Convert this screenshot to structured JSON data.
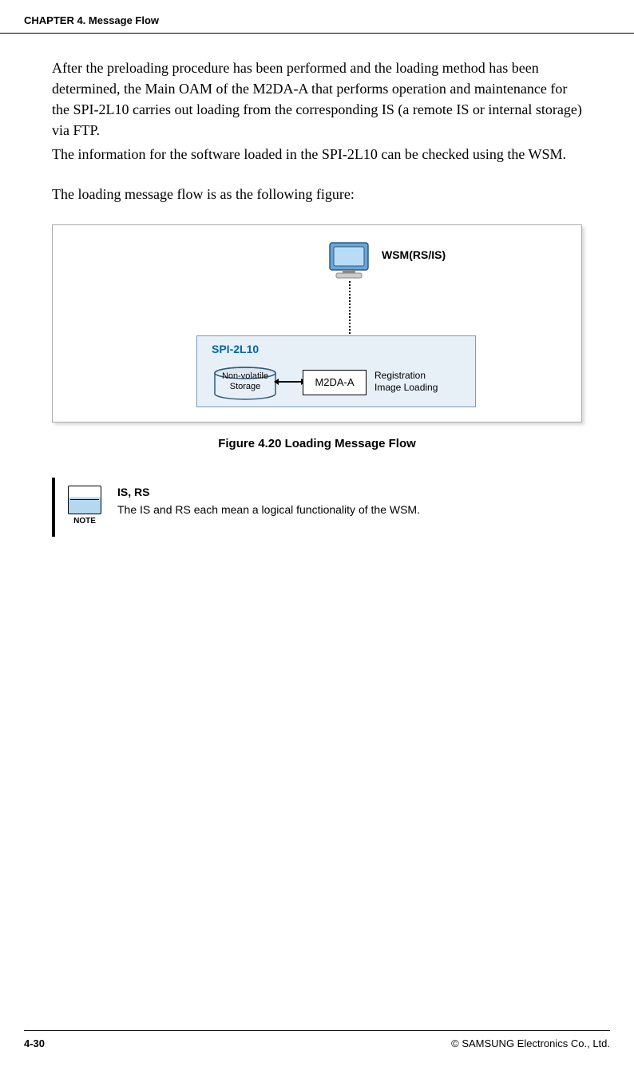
{
  "header": {
    "chapter": "CHAPTER 4. Message Flow"
  },
  "body": {
    "para1": "After the preloading procedure has been performed and the loading method has been determined, the Main OAM of the M2DA-A that performs operation and maintenance for the SPI-2L10 carries out loading from the corresponding IS (a remote IS or internal storage) via FTP.",
    "para2": "The information for the software loaded in the SPI-2L10 can be checked using the WSM.",
    "para3": "The loading message flow is as the following figure:"
  },
  "diagram": {
    "wsm_label": "WSM(RS/IS)",
    "spi_label": "SPI-2L10",
    "storage_line1": "Non-volatile",
    "storage_line2": "Storage",
    "m2da": "M2DA-A",
    "reg_line1": "Registration",
    "reg_line2": "Image Loading"
  },
  "figure_caption": "Figure 4.20    Loading Message Flow",
  "note": {
    "icon_label": "NOTE",
    "title": "IS, RS",
    "text": "The IS and RS each mean a logical functionality of the WSM."
  },
  "footer": {
    "page": "4-30",
    "copyright": "© SAMSUNG Electronics Co., Ltd."
  }
}
